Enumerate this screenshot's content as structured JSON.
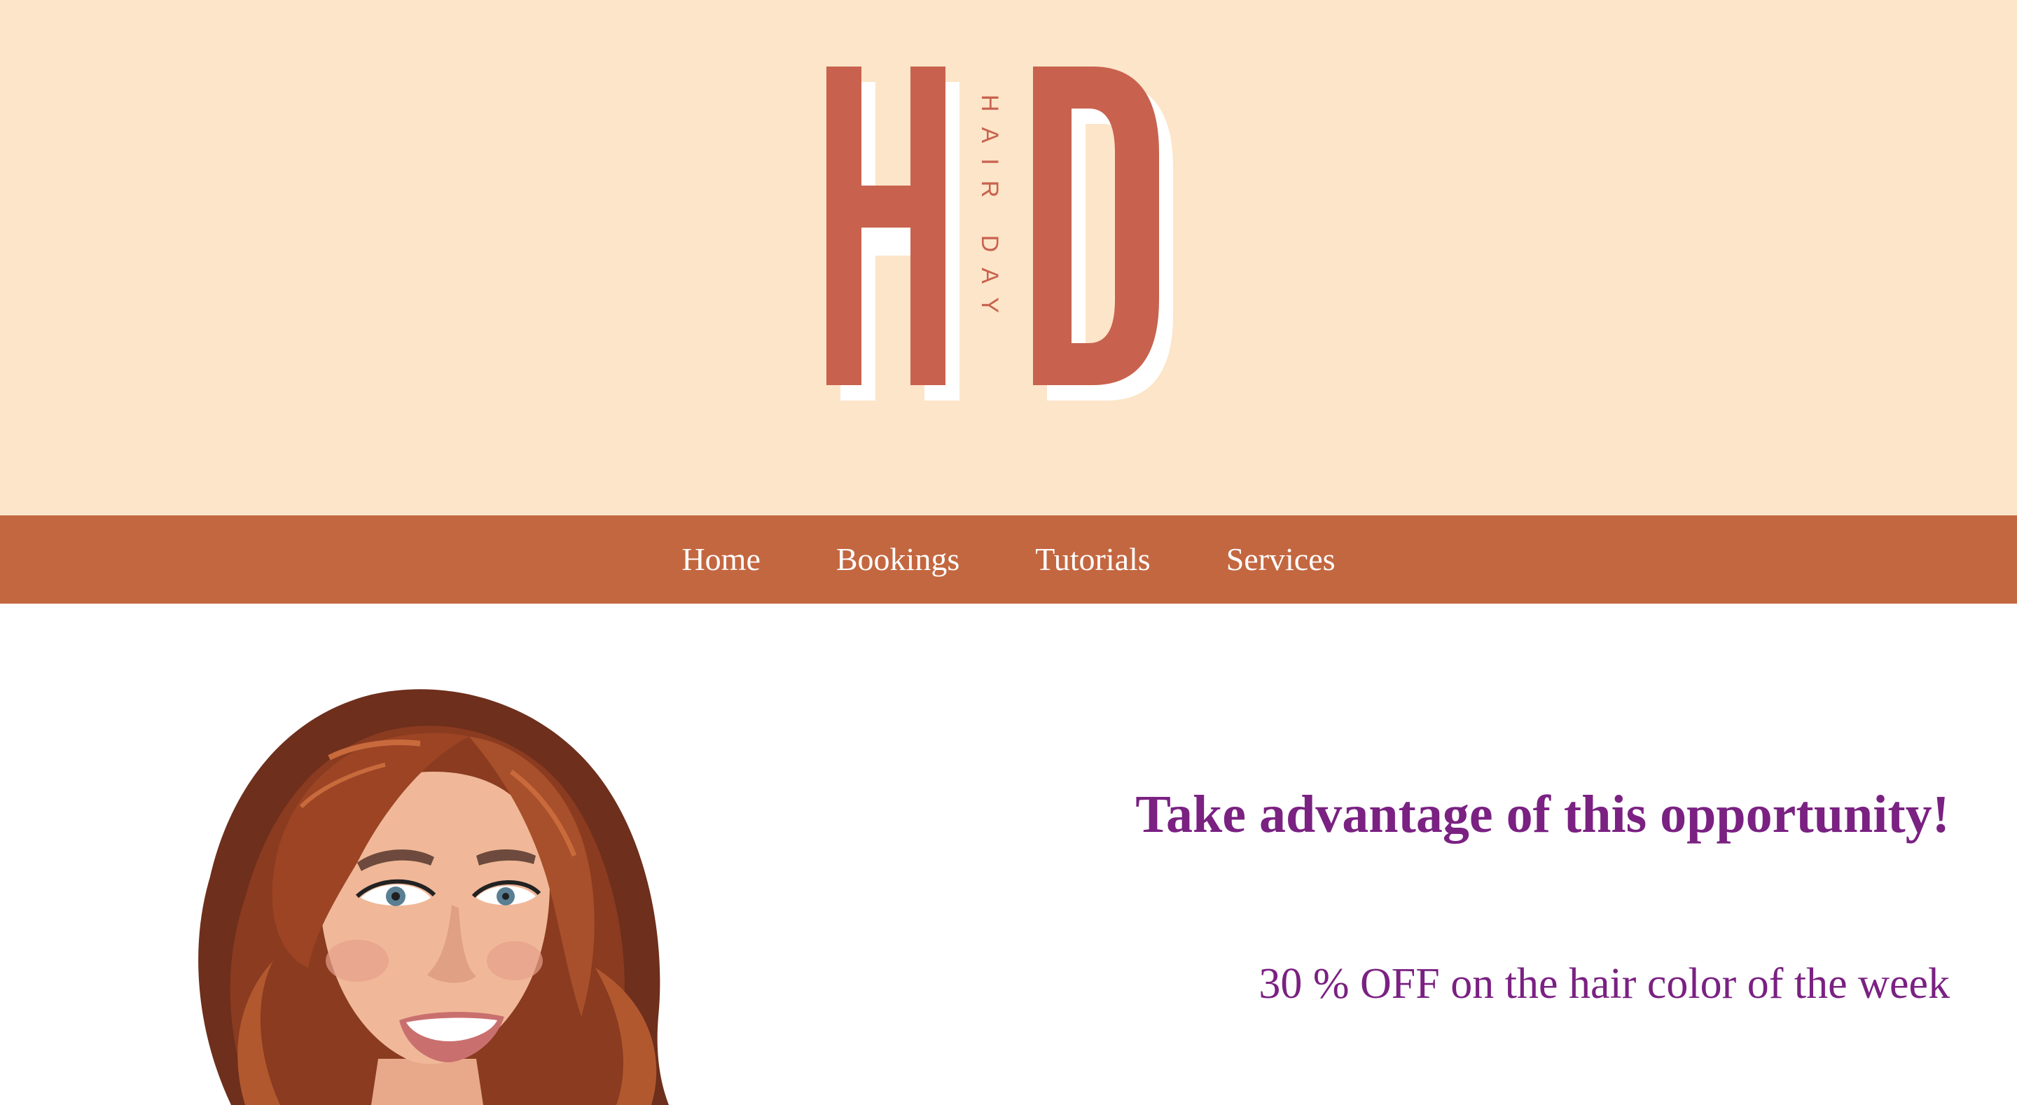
{
  "brand": {
    "logo_letters": "HD",
    "logo_wordmark": "HAIR DAY",
    "logo_color": "#c8624f",
    "header_background": "#fce5c8"
  },
  "nav": {
    "background": "#c36740",
    "items": [
      {
        "label": "Home"
      },
      {
        "label": "Bookings"
      },
      {
        "label": "Tutorials"
      },
      {
        "label": "Services"
      }
    ]
  },
  "promo": {
    "title": "Take advantage of this opportunity!",
    "subtitle": "30 % OFF on the hair color of the week",
    "text_color": "#7a2182"
  },
  "hero": {
    "image": "illustrated-woman-portrait"
  }
}
